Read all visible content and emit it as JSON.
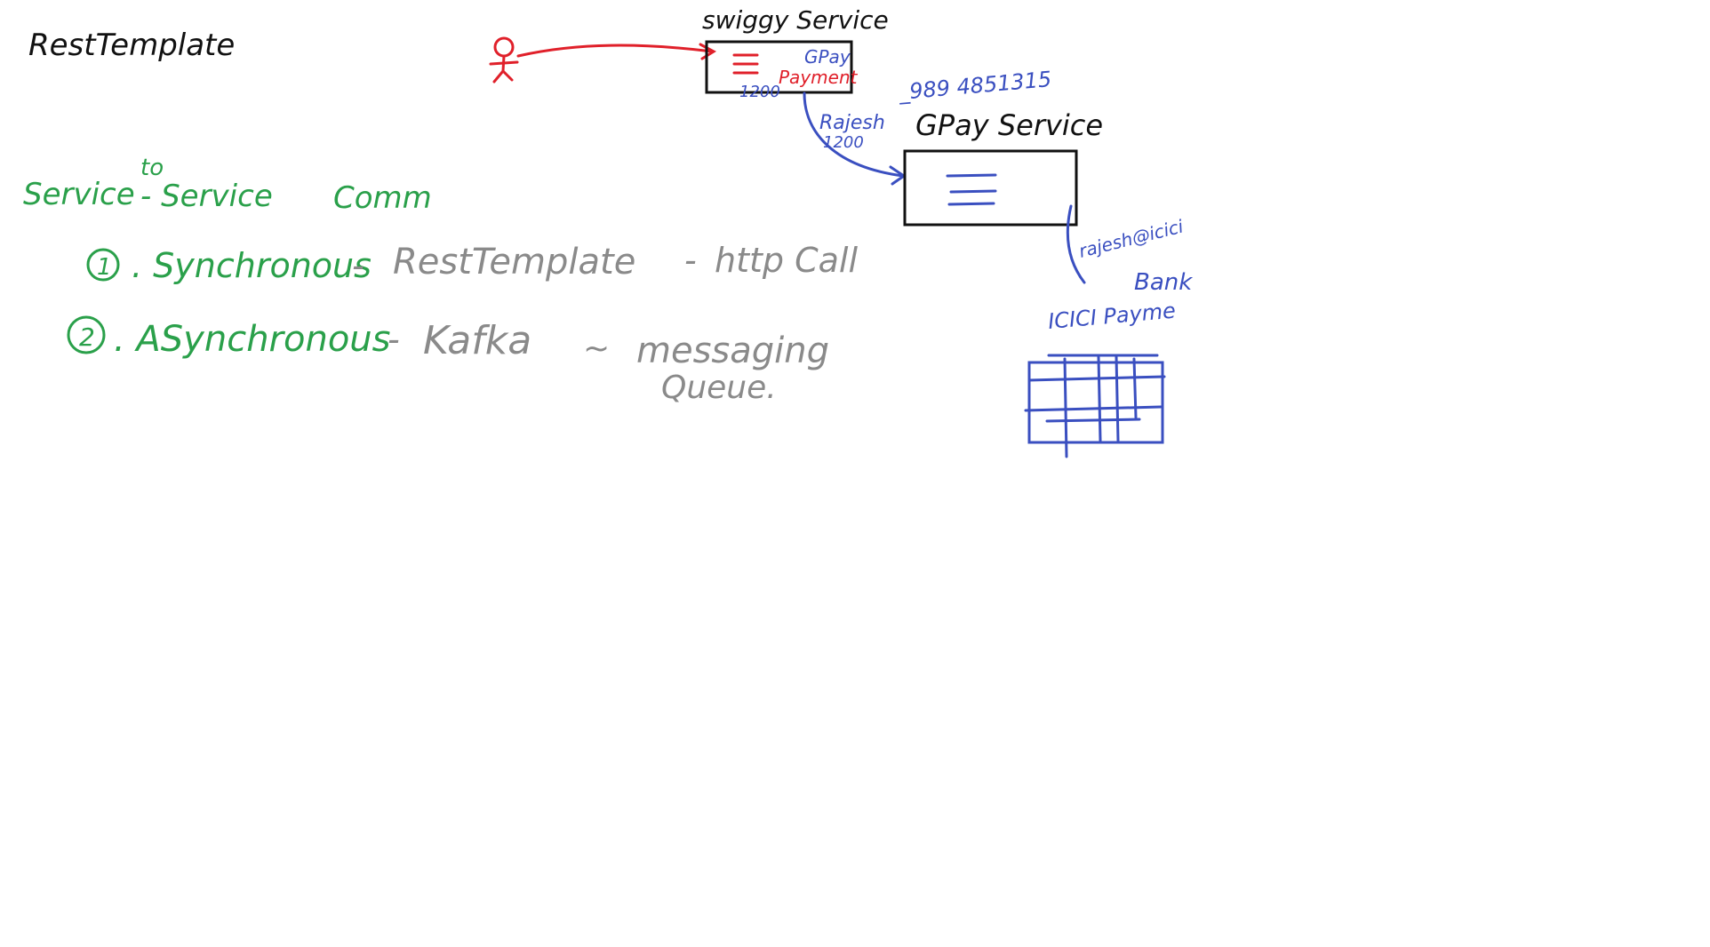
{
  "board": {
    "title": "RestTemplate"
  },
  "colors": {
    "black": "#111111",
    "red": "#e0202a",
    "blue": "#3a4fc0",
    "green": "#2aa04a",
    "gray": "#8a8a8a"
  },
  "notes": {
    "service_comm": {
      "part1": "Service",
      "to": "to",
      "part2": "- Service",
      "part3": "Comm"
    },
    "item1": {
      "num": "1",
      "label": ". Synchronous",
      "dash1": "-",
      "tech": "RestTemplate",
      "dash2": "-",
      "detail": "http Call"
    },
    "item2": {
      "num": "2",
      "label": ". ASynchronous",
      "dash1": "-",
      "tech": "Kafka",
      "dash2": "~",
      "detail": "messaging",
      "detail2": "Queue."
    }
  },
  "diagram": {
    "swiggy_title": "swiggy Service",
    "swiggy_gpay": "GPay",
    "swiggy_payment": "Payment",
    "swiggy_amount": "1200",
    "phone": "_989 4851315",
    "request_name": "Rajesh",
    "request_amount": "1200",
    "gpay_title": "GPay Service",
    "upi_id": "rajesh@icici",
    "bank_label": "Bank",
    "icici_label": "ICICI Payme"
  }
}
